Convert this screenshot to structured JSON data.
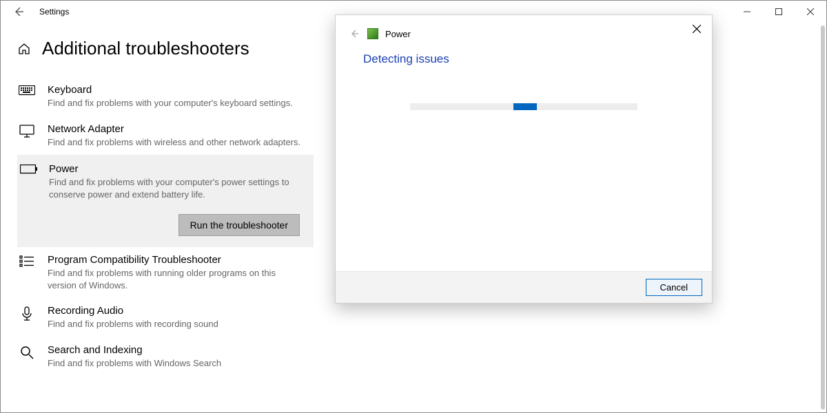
{
  "titlebar": {
    "title": "Settings"
  },
  "page": {
    "title": "Additional troubleshooters"
  },
  "items": [
    {
      "title": "Keyboard",
      "desc": "Find and fix problems with your computer's keyboard settings."
    },
    {
      "title": "Network Adapter",
      "desc": "Find and fix problems with wireless and other network adapters."
    },
    {
      "title": "Power",
      "desc": "Find and fix problems with your computer's power settings to conserve power and extend battery life."
    },
    {
      "title": "Program Compatibility Troubleshooter",
      "desc": "Find and fix problems with running older programs on this version of Windows."
    },
    {
      "title": "Recording Audio",
      "desc": "Find and fix problems with recording sound"
    },
    {
      "title": "Search and Indexing",
      "desc": "Find and fix problems with Windows Search"
    }
  ],
  "run_button": "Run the troubleshooter",
  "dialog": {
    "title": "Power",
    "status": "Detecting issues",
    "cancel": "Cancel"
  }
}
